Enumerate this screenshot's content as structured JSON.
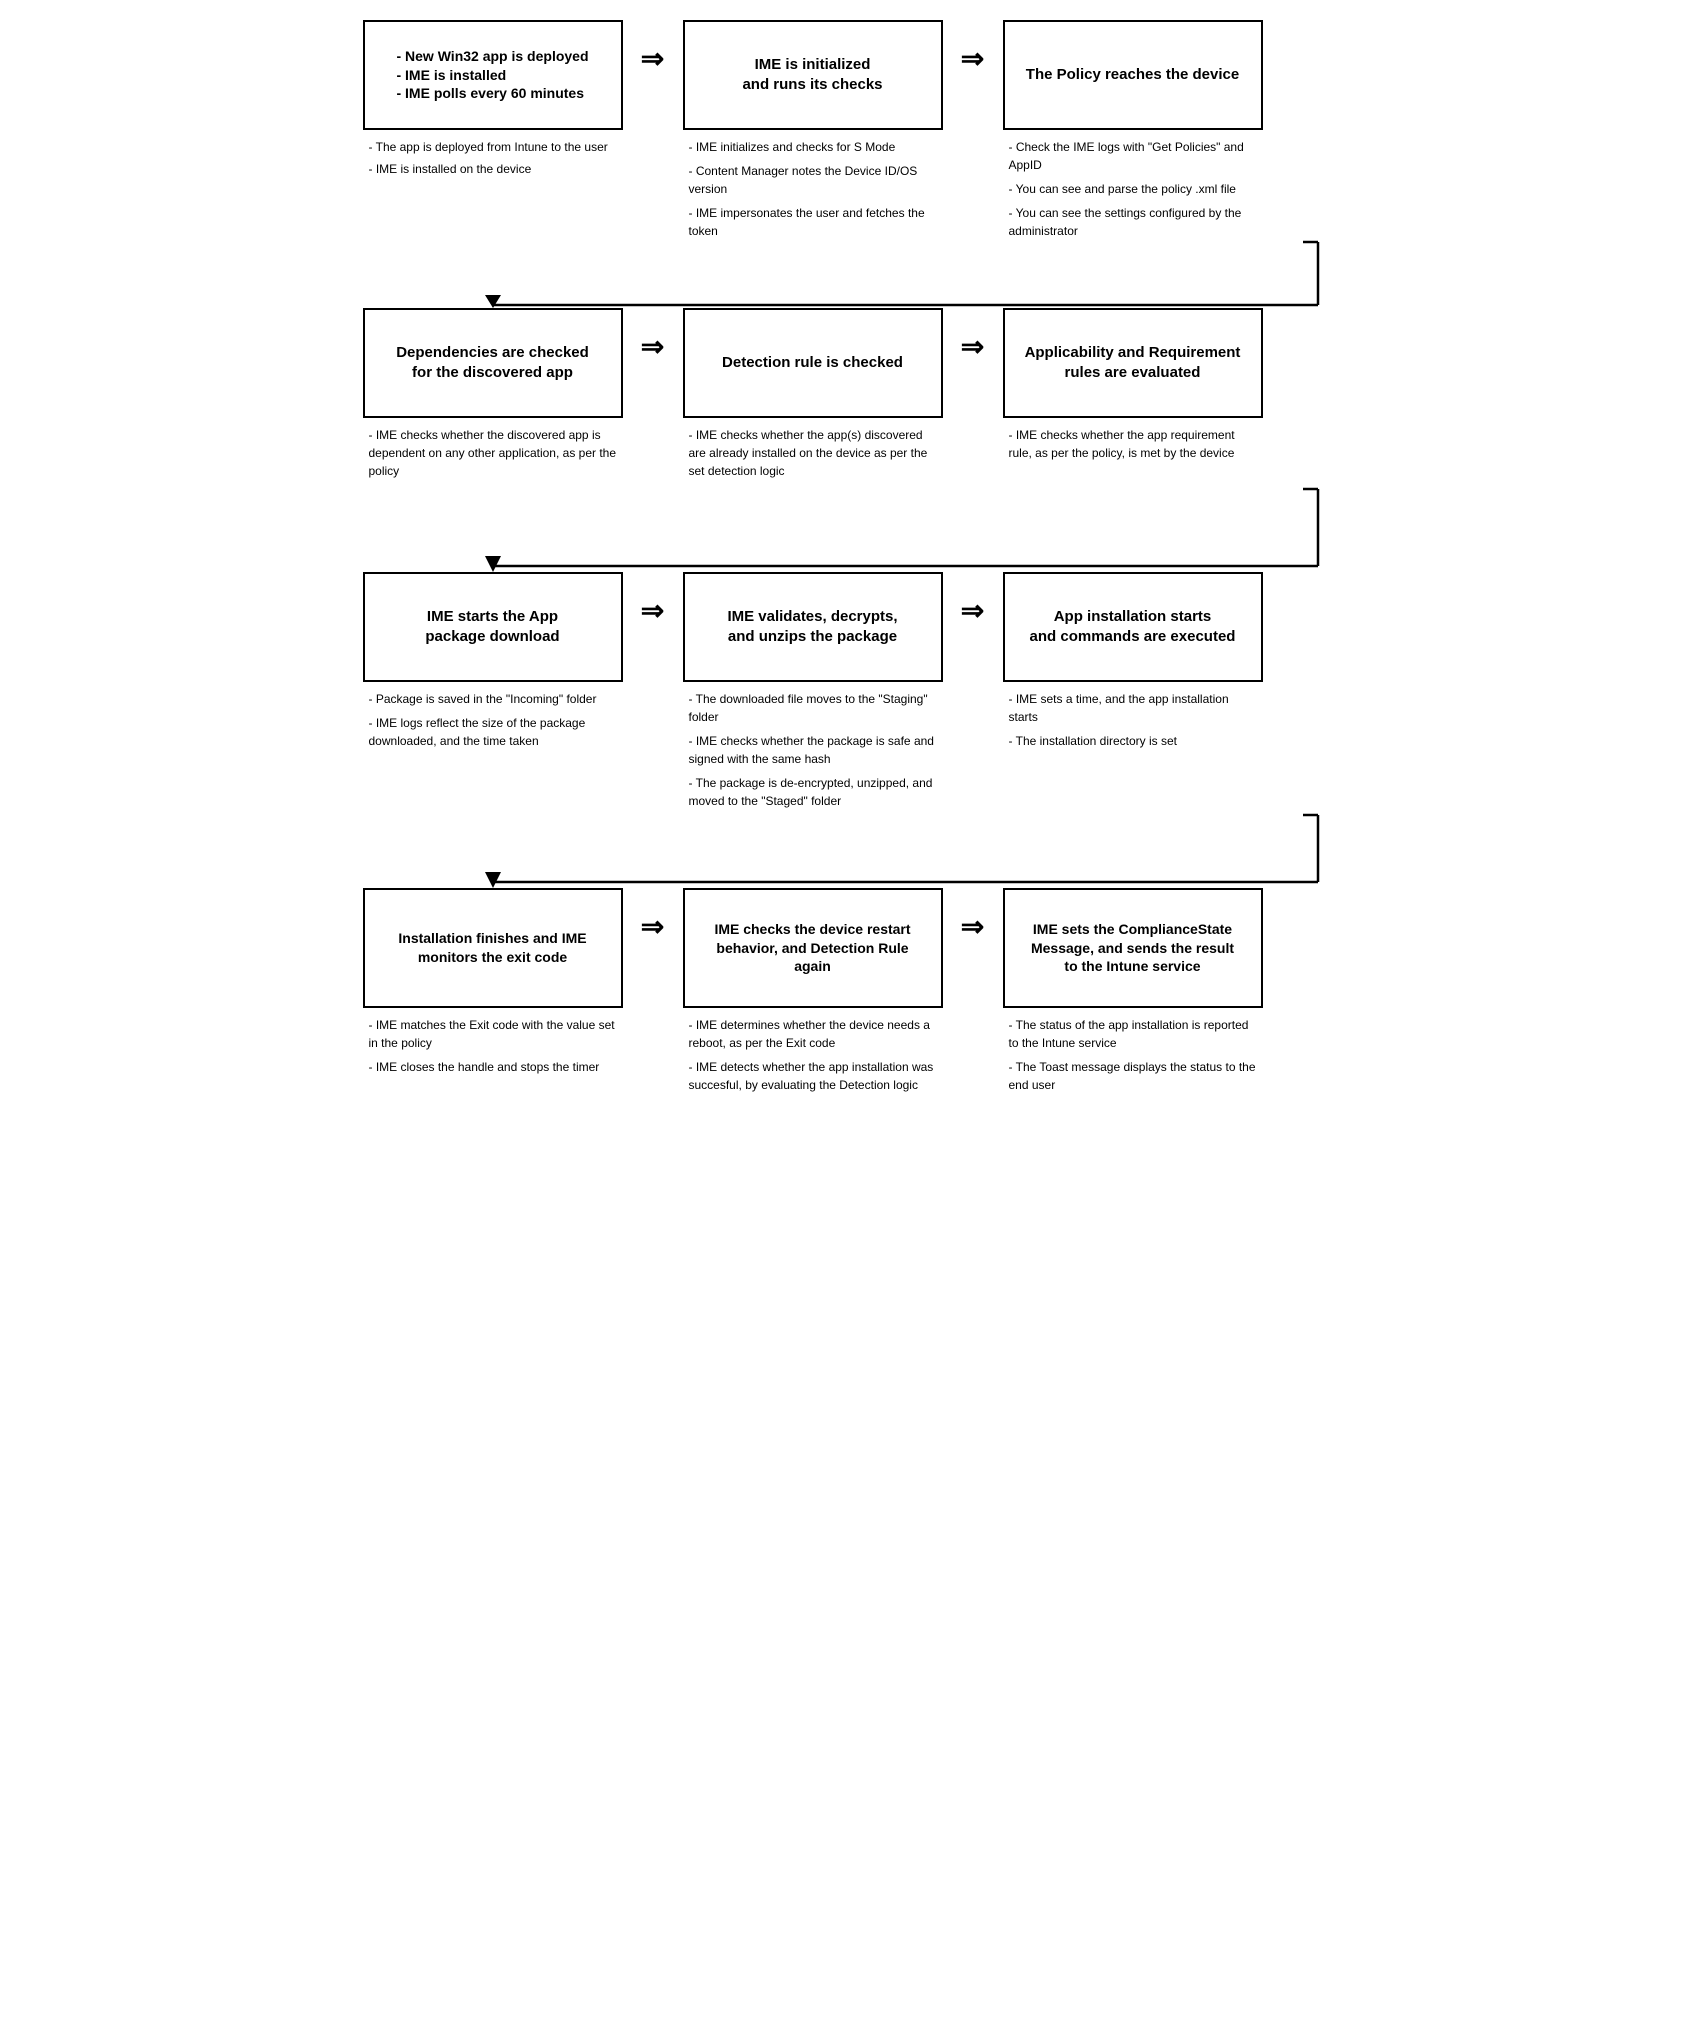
{
  "diagram": {
    "rows": [
      {
        "id": "row1",
        "boxes": [
          {
            "id": "box1",
            "title": "- New Win32 app is deployed\n- IME is installed\n- IME polls every 60 minutes",
            "notes": [
              "- The app is deployed from Intune to the user",
              "- IME is installed on the device"
            ]
          },
          {
            "id": "box2",
            "title": "IME is initialized\nand runs its checks",
            "notes": [
              "- IME initializes and checks for S Mode",
              "- Content Manager notes the Device ID/OS version",
              "- IME impersonates the user and fetches the token"
            ]
          },
          {
            "id": "box3",
            "title": "The Policy reaches the device",
            "notes": [
              "- Check the IME logs with \"Get Policies\" and AppID",
              "- You can see and parse the policy .xml file",
              "- You can see the settings configured by the administrator"
            ]
          }
        ]
      },
      {
        "id": "row2",
        "boxes": [
          {
            "id": "box4",
            "title": "Dependencies are checked\nfor the discovered app",
            "notes": [
              "- IME checks whether the discovered app is dependent on any other application, as per the policy"
            ]
          },
          {
            "id": "box5",
            "title": "Detection rule is checked",
            "notes": [
              "- IME checks whether the app(s) discovered are already installed on the device as per the set detection logic"
            ]
          },
          {
            "id": "box6",
            "title": "Applicability and Requirement rules are evaluated",
            "notes": [
              "- IME checks whether the app requirement rule, as per the policy, is met by the device"
            ]
          }
        ]
      },
      {
        "id": "row3",
        "boxes": [
          {
            "id": "box7",
            "title": "IME starts the App\npackage download",
            "notes": [
              "- Package is saved in the \"Incoming\" folder",
              "- IME logs reflect the size of the package downloaded, and the time taken"
            ]
          },
          {
            "id": "box8",
            "title": "IME validates, decrypts,\nand unzips the package",
            "notes": [
              "- The downloaded file moves to the \"Staging\" folder",
              "- IME checks whether the package is safe and signed with the same hash",
              "- The package is de-encrypted, unzipped, and moved to the \"Staged\" folder"
            ]
          },
          {
            "id": "box9",
            "title": "App installation starts\nand commands are executed",
            "notes": [
              "- IME sets a time, and the app installation starts",
              "- The installation directory is set"
            ]
          }
        ]
      },
      {
        "id": "row4",
        "boxes": [
          {
            "id": "box10",
            "title": "Installation finishes and IME\nmonitors the exit code",
            "notes": [
              "- IME matches the Exit code with the value set in the policy",
              "- IME closes the handle and stops the timer"
            ]
          },
          {
            "id": "box11",
            "title": "IME checks the device restart\nbehavior, and Detection Rule\nagain",
            "notes": [
              "- IME determines whether the device needs a reboot, as per the Exit code",
              "- IME detects whether the app installation was succesful, by evaluating the Detection logic"
            ]
          },
          {
            "id": "box12",
            "title": "IME sets the ComplianceState\nMessage, and sends the result\nto the Intune service",
            "notes": [
              "- The status of the app installation is reported to the Intune service",
              "- The Toast message displays the status to the end user"
            ]
          }
        ]
      }
    ],
    "arrows": {
      "right": "⇒",
      "down": "⇓"
    }
  }
}
